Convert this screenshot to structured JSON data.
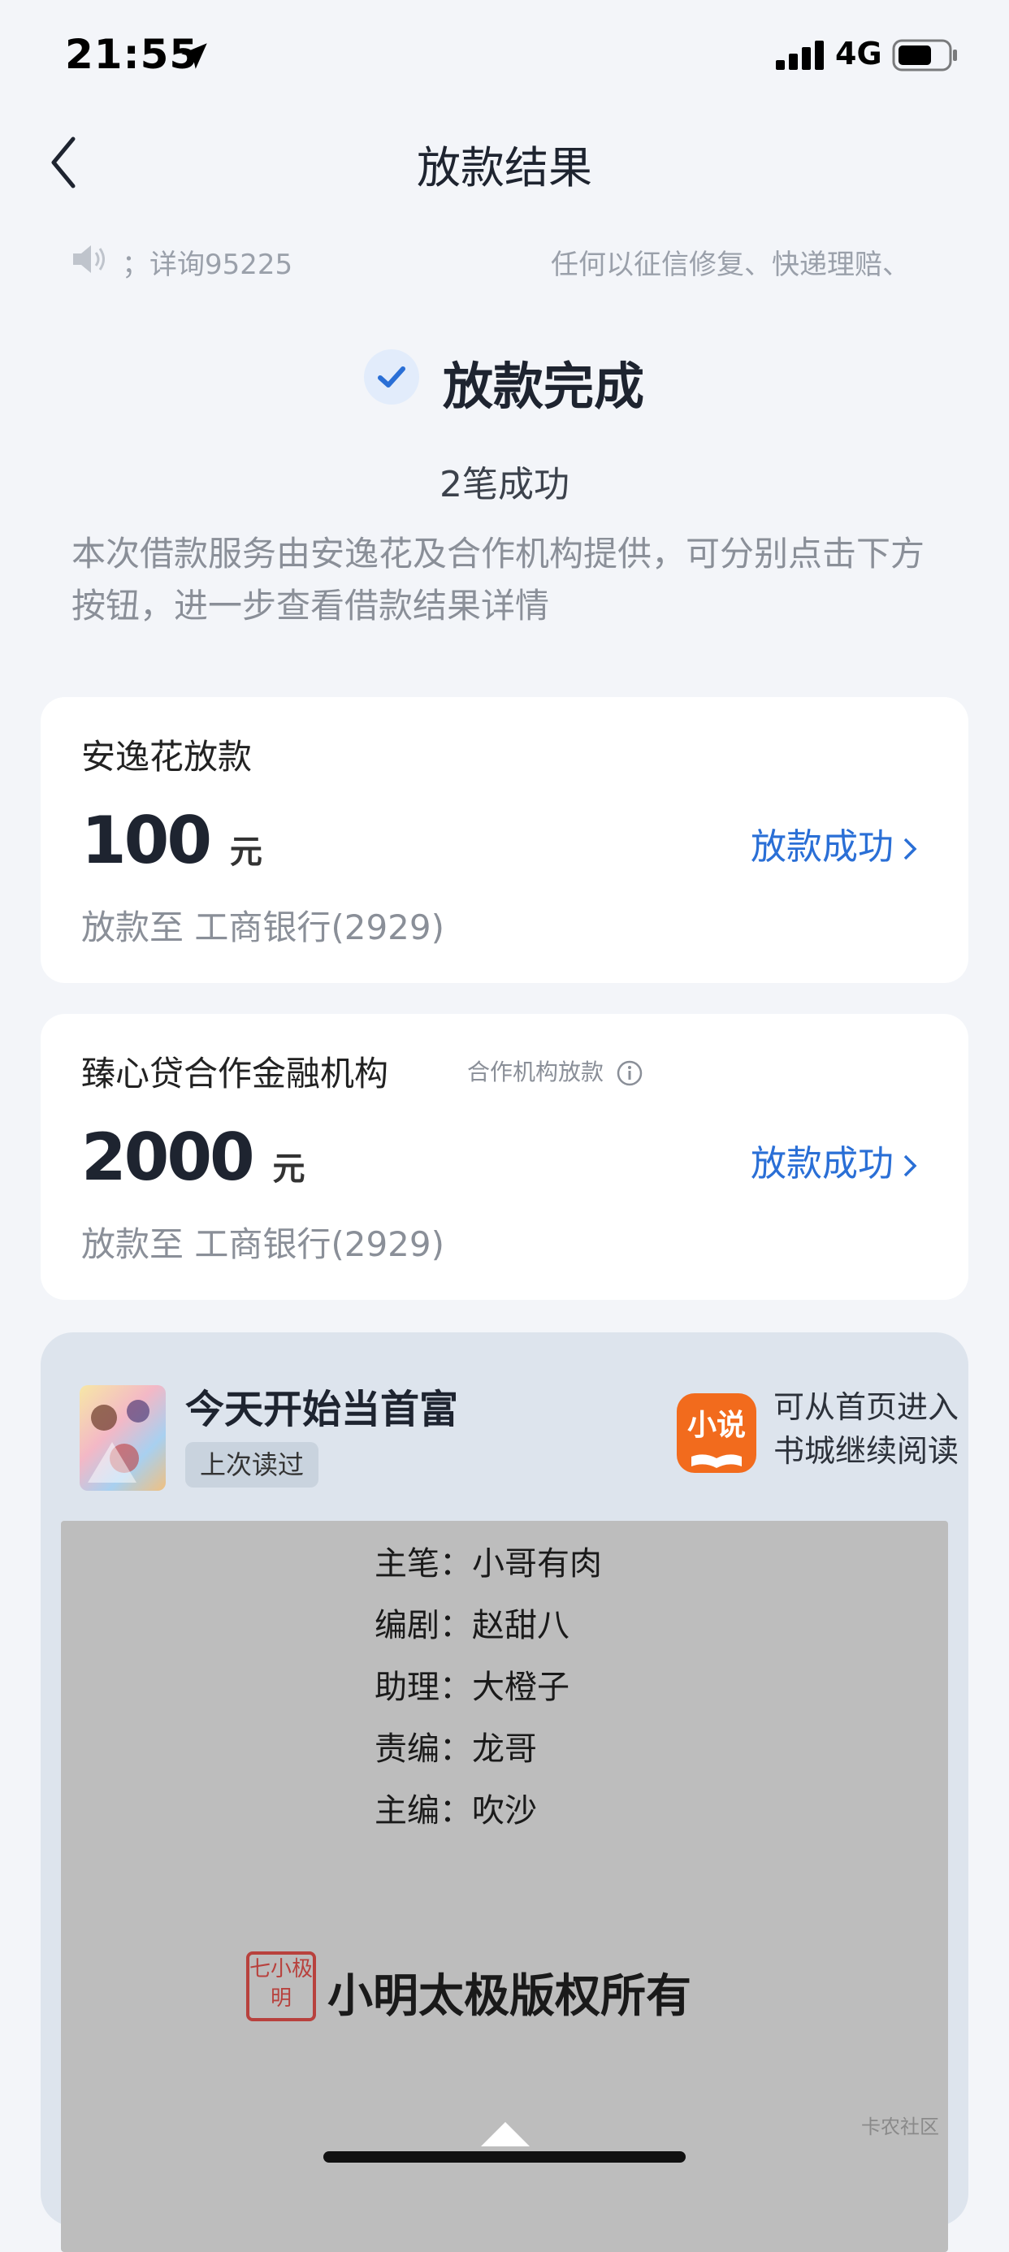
{
  "status_bar": {
    "time": "21:55",
    "network": "4G"
  },
  "nav": {
    "title": "放款结果"
  },
  "notice": {
    "left_text": "；详询95225",
    "right_text": "任何以征信修复、快递理赔、"
  },
  "result": {
    "title": "放款完成",
    "count": "2笔成功",
    "description": "本次借款服务由安逸花及合作机构提供，可分别点击下方按钮，进一步查看借款结果详情"
  },
  "cards": [
    {
      "title": "安逸花放款",
      "amount": "100",
      "unit": "元",
      "status": "放款成功",
      "sub": "放款至 工商银行(2929)"
    },
    {
      "title": "臻心贷合作金融机构",
      "tag": "合作机构放款",
      "amount": "2000",
      "unit": "元",
      "status": "放款成功",
      "sub": "放款至 工商银行(2929)"
    }
  ],
  "book": {
    "title": "今天开始当首富",
    "read_tag": "上次读过",
    "app_logo": "小说",
    "app_hint_line1": "可从首页进入",
    "app_hint_line2": "书城继续阅读",
    "credits": [
      "主笔：小哥有肉",
      "编剧：赵甜八",
      "助理：大橙子",
      "责编：龙哥",
      "主编：吹沙"
    ],
    "stamp": "七小极明",
    "copyright": "小明太极版权所有"
  },
  "watermark": "卡农社区"
}
